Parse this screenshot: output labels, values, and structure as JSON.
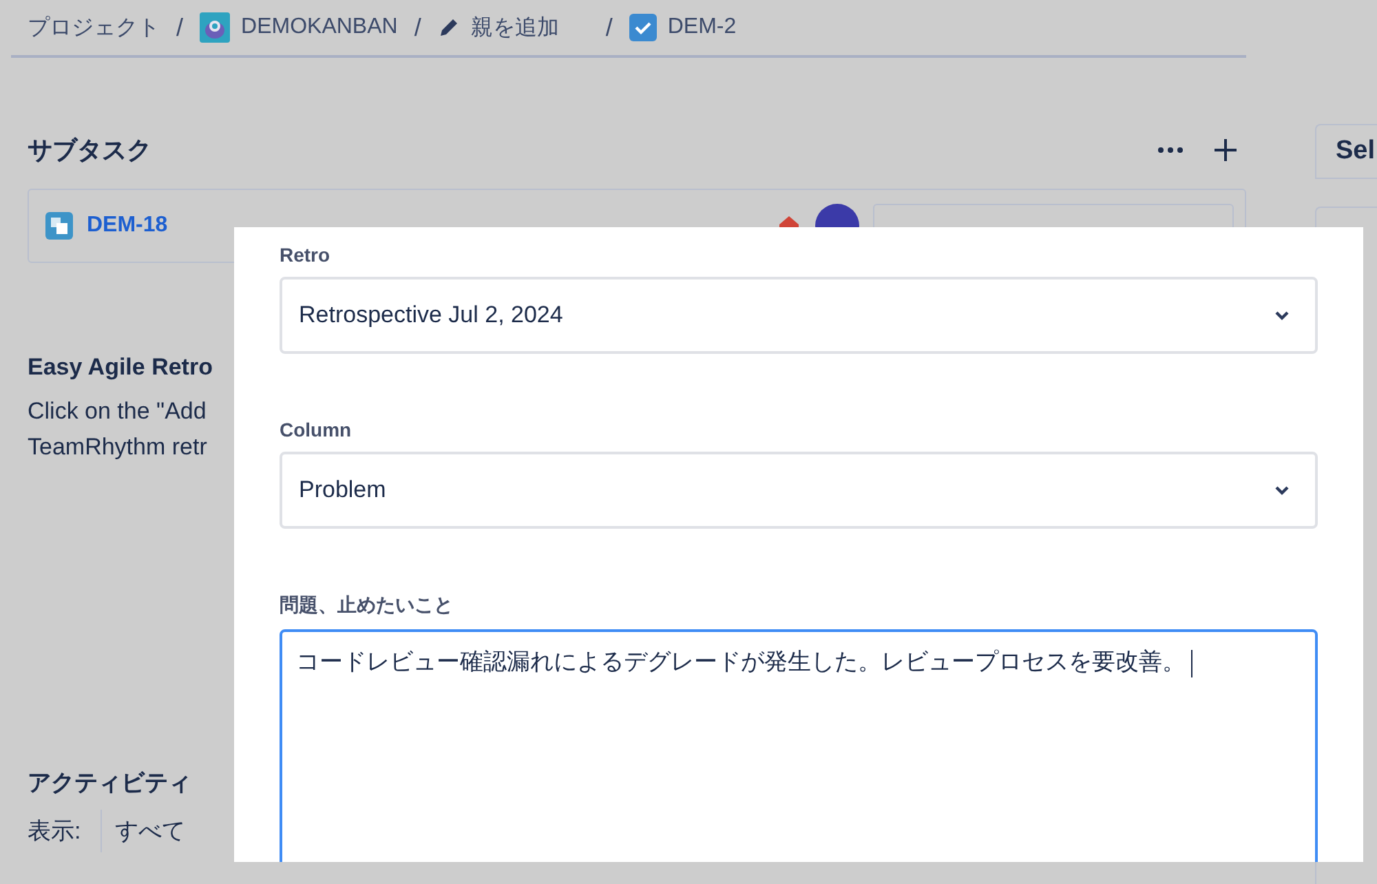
{
  "breadcrumb_separator": "/",
  "breadcrumbs": [
    {
      "kind": "text",
      "label": "プロジェクト"
    },
    {
      "kind": "project",
      "label": "DEMOKANBAN"
    },
    {
      "kind": "edit",
      "label": "親を追加"
    },
    {
      "kind": "issue",
      "label": "DEM-2"
    }
  ],
  "subtasks": {
    "title": "サブタスク",
    "items": [
      {
        "key": "DEM-18"
      }
    ]
  },
  "retro_panel": {
    "title": "Easy Agile Retro",
    "lines": [
      "Click on the \"Add",
      "TeamRhythm retr"
    ]
  },
  "activity": {
    "title": "アクティビティ",
    "show_label": "表示:",
    "filters": [
      "すべて"
    ]
  },
  "side_panel": {
    "tab": "Sel"
  },
  "dialog": {
    "fields": [
      {
        "kind": "select",
        "label": "Retro",
        "value": "Retrospective Jul 2, 2024"
      },
      {
        "kind": "select",
        "label": "Column",
        "value": "Problem"
      },
      {
        "kind": "textarea",
        "label": "問題、止めたいこと",
        "value": "コードレビュー確認漏れによるデグレードが発生した。レビュープロセスを要改善。",
        "focused": true
      }
    ]
  }
}
